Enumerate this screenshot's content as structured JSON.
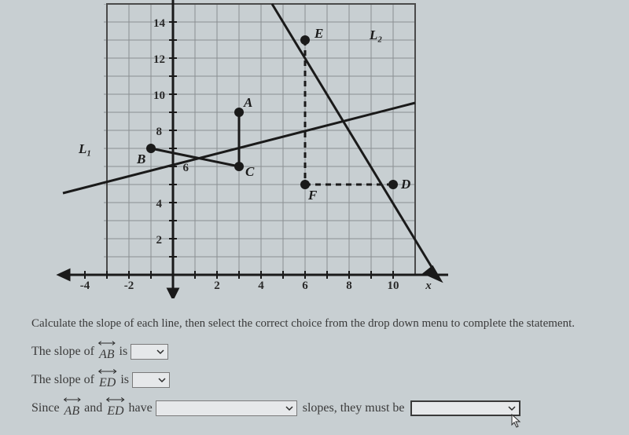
{
  "chart_data": {
    "type": "scatter",
    "title": "",
    "xlabel": "x",
    "ylabel": "",
    "xlim": [
      -5,
      12
    ],
    "ylim": [
      -1,
      15
    ],
    "x_ticks": [
      -4,
      -2,
      2,
      4,
      6,
      8,
      10
    ],
    "y_ticks": [
      2,
      4,
      6,
      8,
      10,
      12,
      14
    ],
    "points": [
      {
        "name": "A",
        "x": 3,
        "y": 9
      },
      {
        "name": "B",
        "x": -1,
        "y": 7
      },
      {
        "name": "C",
        "x": 3,
        "y": 6
      },
      {
        "name": "E",
        "x": 6,
        "y": 13
      },
      {
        "name": "F",
        "x": 6,
        "y": 5
      },
      {
        "name": "D",
        "x": 10,
        "y": 5
      }
    ],
    "lines": [
      {
        "name": "L1",
        "through": [
          "B",
          "A"
        ],
        "extends": true,
        "label_pos": [
          -4.5,
          6
        ]
      },
      {
        "name": "L2",
        "through": [
          "E",
          "D"
        ],
        "extends": true,
        "label_pos": [
          9.5,
          13
        ]
      }
    ],
    "aux_segments": [
      {
        "from": "B",
        "to": "C",
        "style": "solid"
      },
      {
        "from": "A",
        "to": "C",
        "style": "solid"
      },
      {
        "from": "E",
        "to": "F",
        "style": "dashed"
      },
      {
        "from": "F",
        "to": "D",
        "style": "dashed"
      }
    ]
  },
  "question": {
    "instruction": "Calculate the slope of each line, then select the correct choice from the drop down menu to complete the statement.",
    "row1_prefix": "The slope of ",
    "row1_segment": "AB",
    "row1_suffix": " is ",
    "row2_prefix": "The slope of ",
    "row2_segment": "ED",
    "row2_suffix": " is ",
    "row3_prefix": "Since ",
    "row3_and": " and ",
    "row3_have": " have ",
    "row3_mid": " slopes, they must be ",
    "row3_seg1": "AB",
    "row3_seg2": "ED"
  },
  "axis": {
    "x_label": "x",
    "tick_neg4": "-4",
    "tick_neg2": "-2",
    "tick_2": "2",
    "tick_4": "4",
    "tick_6": "6",
    "tick_8": "8",
    "tick_10": "10",
    "ytick_2": "2",
    "ytick_4": "4",
    "ytick_6": "6",
    "ytick_8": "8",
    "ytick_10": "10",
    "ytick_12": "12",
    "ytick_14": "14"
  },
  "labels": {
    "A": "A",
    "B": "B",
    "C": "C",
    "D": "D",
    "E": "E",
    "F": "F",
    "L1": "L₁",
    "L2": "L₂"
  }
}
